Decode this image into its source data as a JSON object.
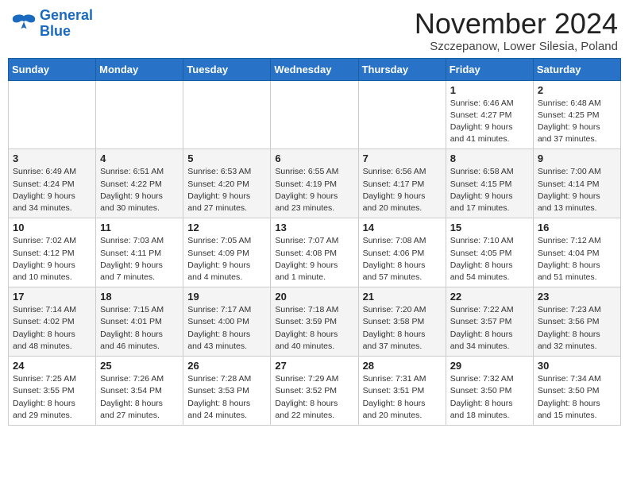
{
  "logo": {
    "line1": "General",
    "line2": "Blue"
  },
  "title": "November 2024",
  "subtitle": "Szczepanow, Lower Silesia, Poland",
  "weekdays": [
    "Sunday",
    "Monday",
    "Tuesday",
    "Wednesday",
    "Thursday",
    "Friday",
    "Saturday"
  ],
  "weeks": [
    [
      {
        "day": "",
        "info": ""
      },
      {
        "day": "",
        "info": ""
      },
      {
        "day": "",
        "info": ""
      },
      {
        "day": "",
        "info": ""
      },
      {
        "day": "",
        "info": ""
      },
      {
        "day": "1",
        "info": "Sunrise: 6:46 AM\nSunset: 4:27 PM\nDaylight: 9 hours and 41 minutes."
      },
      {
        "day": "2",
        "info": "Sunrise: 6:48 AM\nSunset: 4:25 PM\nDaylight: 9 hours and 37 minutes."
      }
    ],
    [
      {
        "day": "3",
        "info": "Sunrise: 6:49 AM\nSunset: 4:24 PM\nDaylight: 9 hours and 34 minutes."
      },
      {
        "day": "4",
        "info": "Sunrise: 6:51 AM\nSunset: 4:22 PM\nDaylight: 9 hours and 30 minutes."
      },
      {
        "day": "5",
        "info": "Sunrise: 6:53 AM\nSunset: 4:20 PM\nDaylight: 9 hours and 27 minutes."
      },
      {
        "day": "6",
        "info": "Sunrise: 6:55 AM\nSunset: 4:19 PM\nDaylight: 9 hours and 23 minutes."
      },
      {
        "day": "7",
        "info": "Sunrise: 6:56 AM\nSunset: 4:17 PM\nDaylight: 9 hours and 20 minutes."
      },
      {
        "day": "8",
        "info": "Sunrise: 6:58 AM\nSunset: 4:15 PM\nDaylight: 9 hours and 17 minutes."
      },
      {
        "day": "9",
        "info": "Sunrise: 7:00 AM\nSunset: 4:14 PM\nDaylight: 9 hours and 13 minutes."
      }
    ],
    [
      {
        "day": "10",
        "info": "Sunrise: 7:02 AM\nSunset: 4:12 PM\nDaylight: 9 hours and 10 minutes."
      },
      {
        "day": "11",
        "info": "Sunrise: 7:03 AM\nSunset: 4:11 PM\nDaylight: 9 hours and 7 minutes."
      },
      {
        "day": "12",
        "info": "Sunrise: 7:05 AM\nSunset: 4:09 PM\nDaylight: 9 hours and 4 minutes."
      },
      {
        "day": "13",
        "info": "Sunrise: 7:07 AM\nSunset: 4:08 PM\nDaylight: 9 hours and 1 minute."
      },
      {
        "day": "14",
        "info": "Sunrise: 7:08 AM\nSunset: 4:06 PM\nDaylight: 8 hours and 57 minutes."
      },
      {
        "day": "15",
        "info": "Sunrise: 7:10 AM\nSunset: 4:05 PM\nDaylight: 8 hours and 54 minutes."
      },
      {
        "day": "16",
        "info": "Sunrise: 7:12 AM\nSunset: 4:04 PM\nDaylight: 8 hours and 51 minutes."
      }
    ],
    [
      {
        "day": "17",
        "info": "Sunrise: 7:14 AM\nSunset: 4:02 PM\nDaylight: 8 hours and 48 minutes."
      },
      {
        "day": "18",
        "info": "Sunrise: 7:15 AM\nSunset: 4:01 PM\nDaylight: 8 hours and 46 minutes."
      },
      {
        "day": "19",
        "info": "Sunrise: 7:17 AM\nSunset: 4:00 PM\nDaylight: 8 hours and 43 minutes."
      },
      {
        "day": "20",
        "info": "Sunrise: 7:18 AM\nSunset: 3:59 PM\nDaylight: 8 hours and 40 minutes."
      },
      {
        "day": "21",
        "info": "Sunrise: 7:20 AM\nSunset: 3:58 PM\nDaylight: 8 hours and 37 minutes."
      },
      {
        "day": "22",
        "info": "Sunrise: 7:22 AM\nSunset: 3:57 PM\nDaylight: 8 hours and 34 minutes."
      },
      {
        "day": "23",
        "info": "Sunrise: 7:23 AM\nSunset: 3:56 PM\nDaylight: 8 hours and 32 minutes."
      }
    ],
    [
      {
        "day": "24",
        "info": "Sunrise: 7:25 AM\nSunset: 3:55 PM\nDaylight: 8 hours and 29 minutes."
      },
      {
        "day": "25",
        "info": "Sunrise: 7:26 AM\nSunset: 3:54 PM\nDaylight: 8 hours and 27 minutes."
      },
      {
        "day": "26",
        "info": "Sunrise: 7:28 AM\nSunset: 3:53 PM\nDaylight: 8 hours and 24 minutes."
      },
      {
        "day": "27",
        "info": "Sunrise: 7:29 AM\nSunset: 3:52 PM\nDaylight: 8 hours and 22 minutes."
      },
      {
        "day": "28",
        "info": "Sunrise: 7:31 AM\nSunset: 3:51 PM\nDaylight: 8 hours and 20 minutes."
      },
      {
        "day": "29",
        "info": "Sunrise: 7:32 AM\nSunset: 3:50 PM\nDaylight: 8 hours and 18 minutes."
      },
      {
        "day": "30",
        "info": "Sunrise: 7:34 AM\nSunset: 3:50 PM\nDaylight: 8 hours and 15 minutes."
      }
    ]
  ]
}
